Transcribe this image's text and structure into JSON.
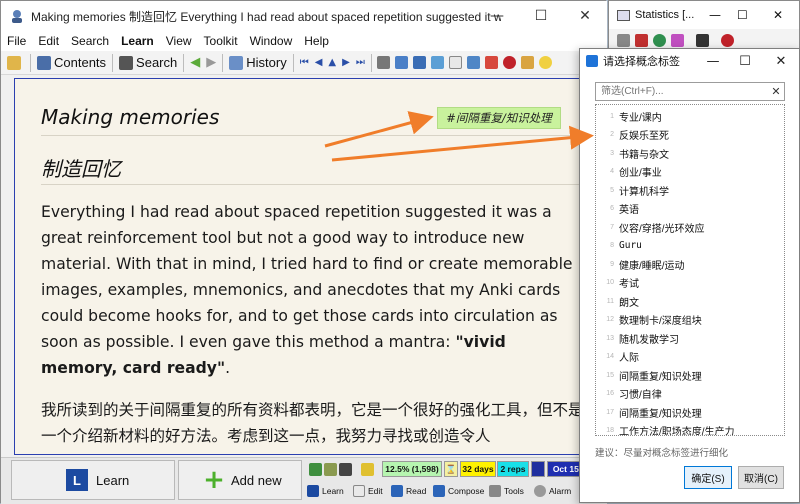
{
  "main_window": {
    "title": "Making memories 制造回忆 Everything I had read about spaced repetition suggested it was a great reinfor...",
    "controls": {
      "minimize": "—",
      "maximize": "☐",
      "close": "✕"
    }
  },
  "menubar": [
    "File",
    "Edit",
    "Search",
    "Learn",
    "View",
    "Toolkit",
    "Window",
    "Help"
  ],
  "toolbar": {
    "contents_label": "Contents",
    "search_label": "Search",
    "history_label": "History"
  },
  "content": {
    "title_en": "Making memories",
    "title_zh": "制造回忆",
    "tag_chip": "#间隔重复/知识处理",
    "para_en_1": "Everything I had read about spaced repetition suggested it was a great reinforcement tool but not a good way to introduce new material. With that in mind, I tried hard to find or create memorable images, examples, mnemonics, and anecdotes that my Anki cards could become hooks for, and to get those cards into circulation as soon as possible. I even gave this method a mantra: ",
    "para_en_bold": "\"vivid memory, card ready\"",
    "para_en_end": ".",
    "para_zh": "我所读到的关于间隔重复的所有资料都表明，它是一个很好的强化工具，但不是一个介绍新材料的好方法。考虑到这一点，我努力寻找或创造令人"
  },
  "bottom": {
    "learn_label": "Learn",
    "add_new_label": "Add new",
    "stats": {
      "percent": "12.5% (1,598)",
      "days": "32 days",
      "reps": "2 reps",
      "date": "Oct 15,"
    },
    "modes": [
      "Learn",
      "Edit",
      "Read",
      "Compose",
      "Tools",
      "Alarm"
    ]
  },
  "stats_window": {
    "title": "Statistics [..."
  },
  "dialog": {
    "title": "请选择概念标签",
    "filter_placeholder": "筛选(Ctrl+F)...",
    "tags": [
      {
        "num": "1",
        "label": "专业/课内"
      },
      {
        "num": "2",
        "label": "反娱乐至死"
      },
      {
        "num": "3",
        "label": "书籍与杂文"
      },
      {
        "num": "4",
        "label": "创业/事业"
      },
      {
        "num": "5",
        "label": "计算机科学"
      },
      {
        "num": "6",
        "label": "英语"
      },
      {
        "num": "7",
        "label": "仪容/穿搭/光环效应"
      },
      {
        "num": "8",
        "label": "Guru"
      },
      {
        "num": "9",
        "label": "健康/睡眠/运动"
      },
      {
        "num": "10",
        "label": "考试"
      },
      {
        "num": "11",
        "label": "朗文"
      },
      {
        "num": "12",
        "label": "数理制卡/深度组块"
      },
      {
        "num": "13",
        "label": "随机发散学习"
      },
      {
        "num": "14",
        "label": "人际"
      },
      {
        "num": "15",
        "label": "间隔重复/知识处理"
      },
      {
        "num": "16",
        "label": "习惯/自律"
      },
      {
        "num": "17",
        "label": "间隔重复/知识处理"
      },
      {
        "num": "18",
        "label": "工作方法/职场态度/生产力"
      }
    ],
    "hint": "建议：尽量对概念标签进行细化",
    "ok_label": "确定(S)",
    "cancel_label": "取消(C)"
  },
  "colors": {
    "accent_blue": "#2b3fb0",
    "tag_chip": "#c9f29d",
    "arrow": "#f07d2a",
    "content_bg": "#f7f3e9"
  }
}
